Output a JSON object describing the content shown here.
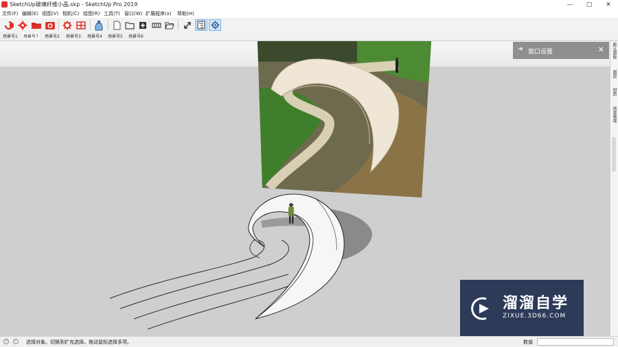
{
  "window": {
    "title": "SketchUp玻璃纤维小品.skp - SketchUp Pro 2019",
    "controls": {
      "minimize": "—",
      "maximize": "▢",
      "close": "✕"
    }
  },
  "menu": [
    {
      "label": "文件(F)"
    },
    {
      "label": "编辑(E)"
    },
    {
      "label": "视图(V)"
    },
    {
      "label": "相机(C)"
    },
    {
      "label": "绘图(R)"
    },
    {
      "label": "工具(T)"
    },
    {
      "label": "窗口(W)"
    },
    {
      "label": "扩展程序(x)"
    },
    {
      "label": "帮助(H)"
    }
  ],
  "toolbar": {
    "icons": [
      "sketchup-logo-icon",
      "gear-icon",
      "folder-red-icon",
      "camera-red-icon",
      "settings-red-icon",
      "grid-icon",
      "bottle-icon",
      "document-icon",
      "folder-icon",
      "plus-box-icon",
      "scale-icon",
      "open-folder-icon",
      "maximize-icon",
      "outliner-icon",
      "settings-icon"
    ],
    "accent": "#e0322b",
    "active_color": "#cce4f7"
  },
  "scene_tabs": [
    {
      "label": "场景号1"
    },
    {
      "label": "场景号7"
    },
    {
      "label": "场景号2"
    },
    {
      "label": "场景号3"
    },
    {
      "label": "场景号4"
    },
    {
      "label": "场景号5"
    },
    {
      "label": "场景号6"
    }
  ],
  "current_scene_index": 1,
  "window_panel": {
    "title": "窗口设置",
    "arrow": "➜",
    "close": "✕"
  },
  "right_tray": {
    "tabs": [
      "默认面板",
      "图层",
      "材质",
      "场景管理"
    ]
  },
  "status": {
    "hint": "选择对象。切换到扩充选择。拖动鼠标选择多项。",
    "measurements_label": "数值",
    "measurements_value": ""
  },
  "watermark": {
    "brand": "溜溜自学",
    "url": "ZIXUE.3D66.COM"
  },
  "colors": {
    "viewport_bg": "#cfcfcf",
    "sky": "#eaeaea",
    "panel": "#8f8f8f",
    "watermark_bg": "#202e4e"
  }
}
